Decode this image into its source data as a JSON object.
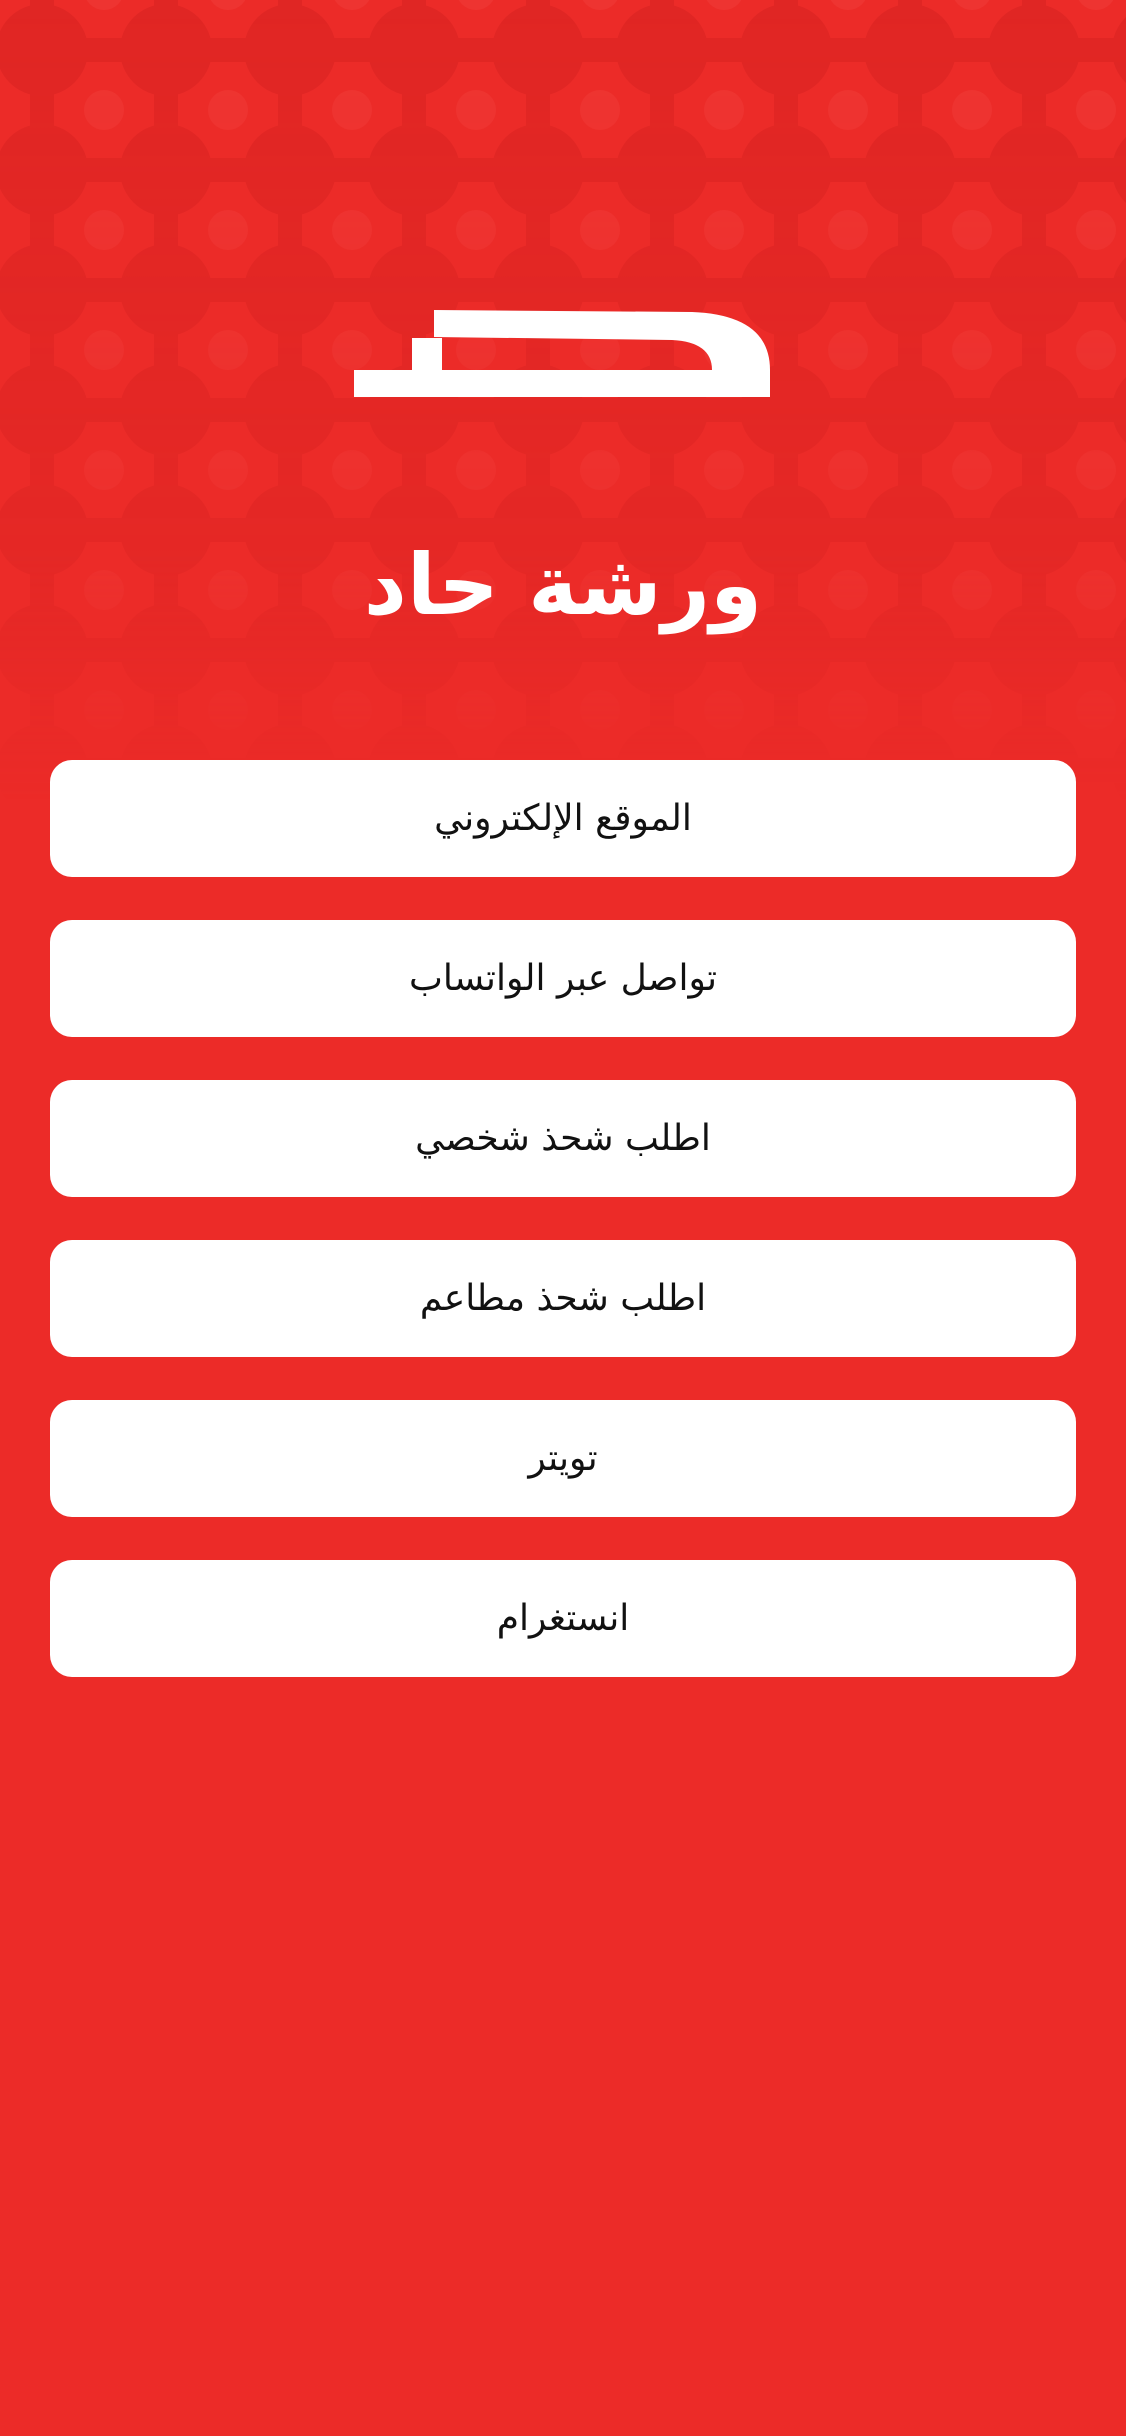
{
  "theme": {
    "background": "#ec2b28",
    "pattern_color": "#e02624",
    "button_background": "#ffffff",
    "button_text": "#111111"
  },
  "brand": {
    "logo_icon": "haad-logo-icon",
    "title": "ورشة حاد"
  },
  "links": [
    {
      "label": "الموقع الإلكتروني"
    },
    {
      "label": "تواصل عبر الواتساب"
    },
    {
      "label": "اطلب شحذ شخصي"
    },
    {
      "label": "اطلب شحذ مطاعم"
    },
    {
      "label": "تويتر"
    },
    {
      "label": "انستغرام"
    }
  ]
}
